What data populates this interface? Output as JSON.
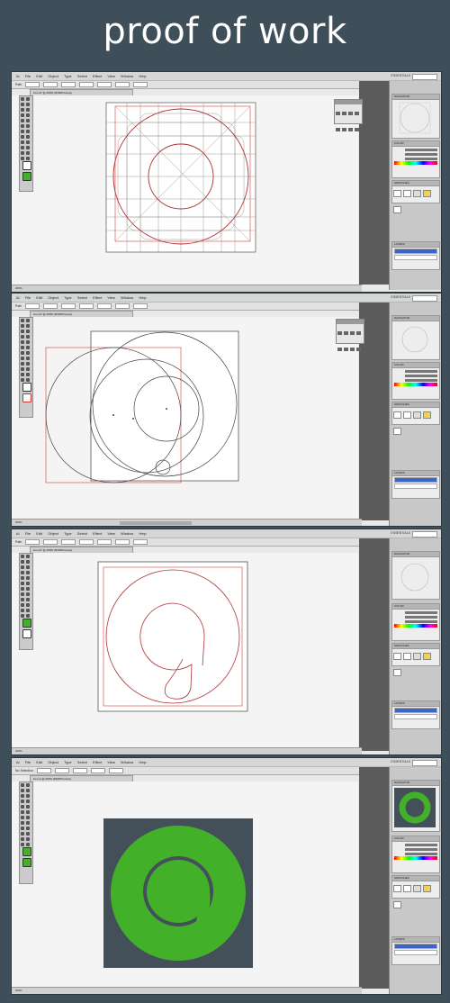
{
  "title": "proof of work",
  "app": {
    "menus": [
      "Ai",
      "File",
      "Edit",
      "Object",
      "Type",
      "Select",
      "Effect",
      "View",
      "Window",
      "Help"
    ],
    "workspace": "ESSENTIALS"
  },
  "panels": {
    "swatches": "SWATCHES",
    "layers": "LAYERS",
    "navigator": "NAVIGATOR",
    "color": "COLOR",
    "layer1": "Layer 1"
  },
  "screens": [
    {
      "ctrl_label": "Path",
      "doc_tab": "icon.ai* @ 200% (RGB/Preview)",
      "status": "200%",
      "step": "grid"
    },
    {
      "ctrl_label": "Path",
      "doc_tab": "icon.ai* @ 200% (RGB/Preview)",
      "status": "200%",
      "step": "circles"
    },
    {
      "ctrl_label": "Path",
      "doc_tab": "icon.ai* @ 200% (RGB/Preview)",
      "status": "200%",
      "step": "outline"
    },
    {
      "ctrl_label": "No Selection",
      "doc_tab": "icon.ai @ 200% (RGB/Preview)",
      "status": "200%",
      "step": "final"
    }
  ],
  "colors": {
    "background": "#3f4f59",
    "brand_green": "#43b02a",
    "art_bg": "#435059",
    "guide_red": "#d23a3a"
  }
}
